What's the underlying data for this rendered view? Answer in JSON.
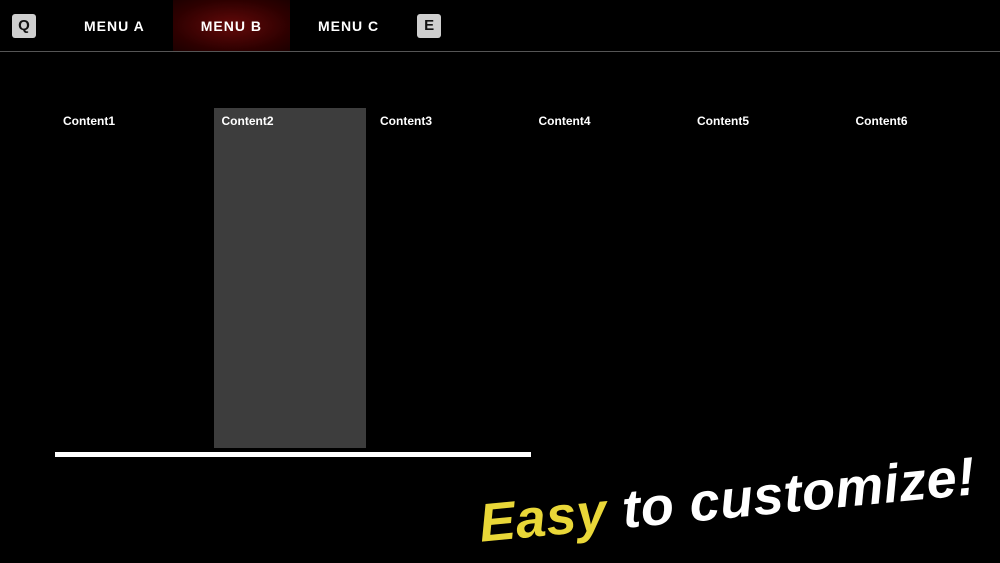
{
  "topbar": {
    "key_left": "Q",
    "key_right": "E",
    "tabs": [
      {
        "label": "MENU A",
        "active": false
      },
      {
        "label": "MENU B",
        "active": true
      },
      {
        "label": "MENU C",
        "active": false
      }
    ]
  },
  "content": {
    "items": [
      {
        "label": "Content1",
        "selected": false
      },
      {
        "label": "Content2",
        "selected": true
      },
      {
        "label": "Content3",
        "selected": false
      },
      {
        "label": "Content4",
        "selected": false
      },
      {
        "label": "Content5",
        "selected": false
      },
      {
        "label": "Content6",
        "selected": false
      }
    ]
  },
  "overlay": {
    "word1": "Easy",
    "word2": " to customize!"
  }
}
